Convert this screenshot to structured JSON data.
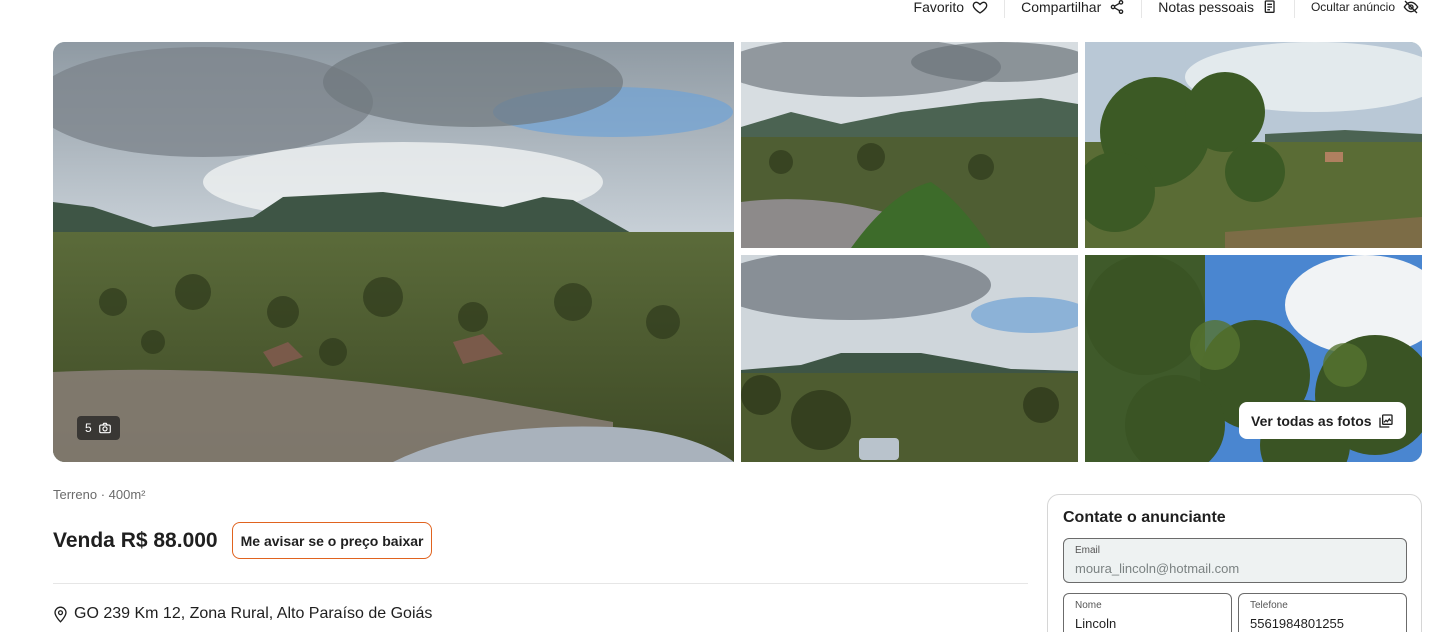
{
  "top_actions": [
    {
      "label": "Favorito",
      "icon": "heart-icon"
    },
    {
      "label": "Compartilhar",
      "icon": "share-icon"
    },
    {
      "label": "Notas pessoais",
      "icon": "notes-icon"
    },
    {
      "label": "Ocultar anúncio",
      "icon": "eye-off-icon"
    }
  ],
  "gallery": {
    "photo_count": "5",
    "photo_count_icon": "camera-icon",
    "view_all_label": "Ver todas as fotos",
    "view_all_icon": "gallery-icon"
  },
  "listing": {
    "type_area": "Terreno · 400m²",
    "price": "Venda R$ 88.000",
    "price_alert_label": "Me avisar se o preço baixar",
    "address": "GO 239 Km 12, Zona Rural, Alto Paraíso de Goiás",
    "address_icon": "location-pin-icon"
  },
  "contact": {
    "title": "Contate o anunciante",
    "email": {
      "label": "Email",
      "value": "moura_lincoln@hotmail.com"
    },
    "name": {
      "label": "Nome",
      "value": "Lincoln"
    },
    "phone": {
      "label": "Telefone",
      "value": "5561984801255"
    }
  },
  "colors": {
    "accent_border": "#e0631f",
    "text": "#1f1f1f",
    "muted": "#6b6b6b"
  }
}
